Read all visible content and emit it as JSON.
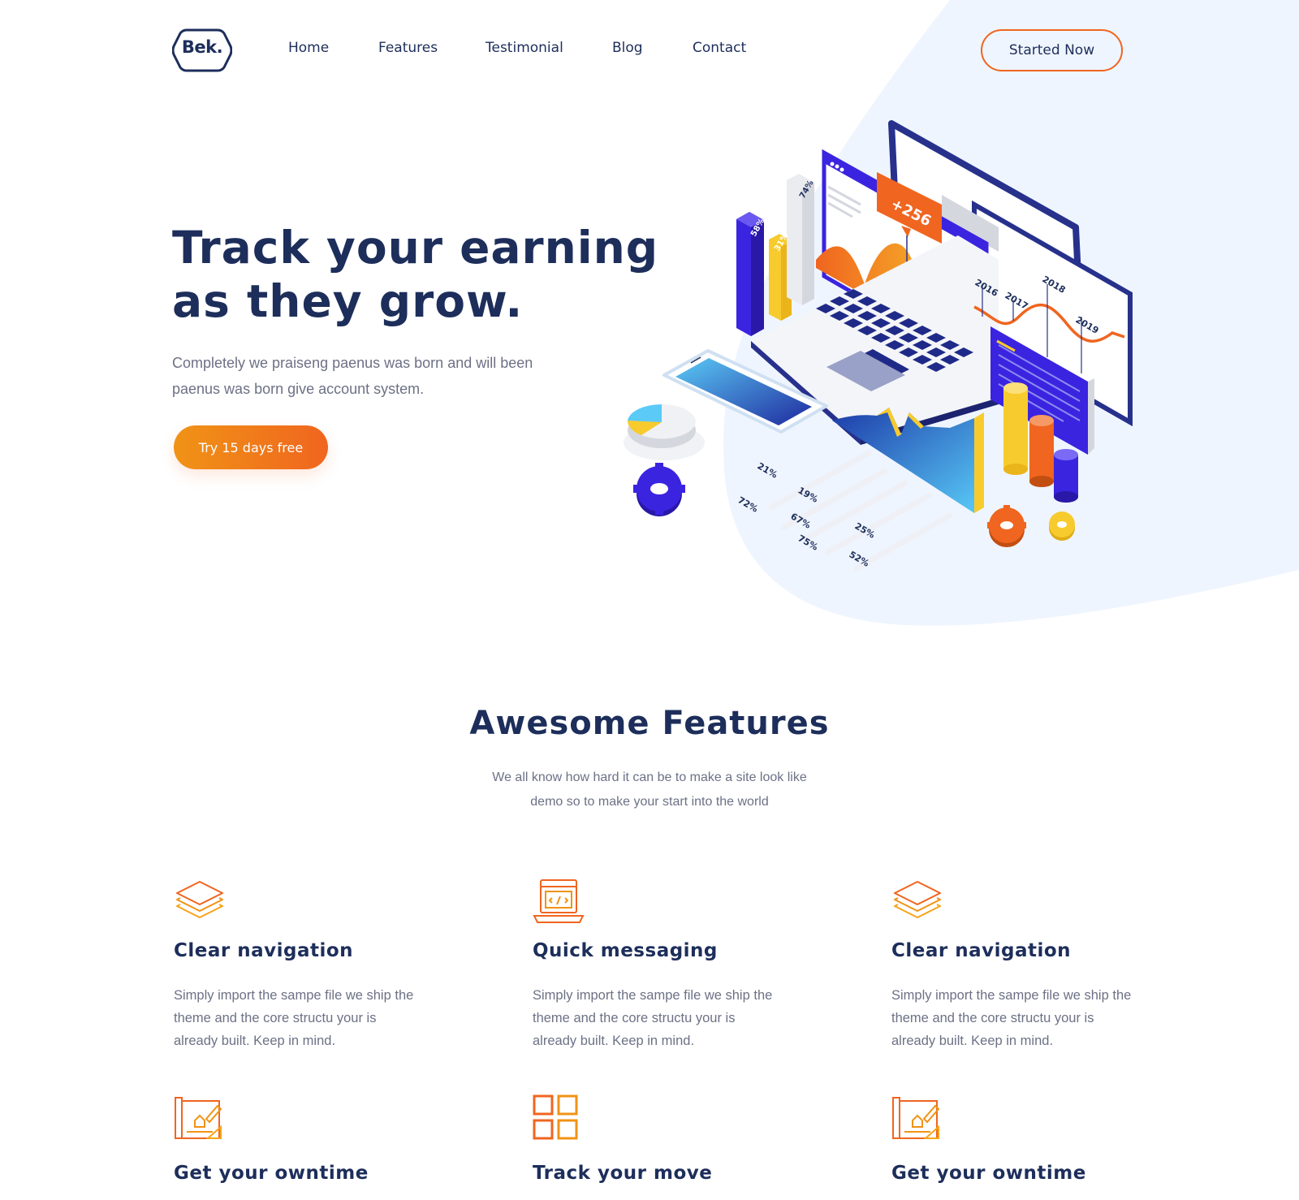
{
  "brand": {
    "logo_text": "Bek."
  },
  "nav": {
    "items": [
      "Home",
      "Features",
      "Testimonial",
      "Blog",
      "Contact"
    ],
    "cta_label": "Started Now"
  },
  "hero": {
    "title_line1": "Track your earning",
    "title_line2": "as they grow.",
    "subtitle_line1": "Completely we praiseng paenus was born and will been",
    "subtitle_line2": "paenus was born give account system.",
    "button_label": "Try 15 days free",
    "illustration": {
      "bar_labels": [
        "58%",
        "31%",
        "74%"
      ],
      "badge": "+256",
      "years": [
        "2016",
        "2017",
        "2018",
        "2019"
      ],
      "floor_labels": [
        "21%",
        "19%",
        "72%",
        "67%",
        "75%",
        "25%",
        "52%"
      ]
    }
  },
  "features": {
    "title": "Awesome Features",
    "subtitle_line1": "We all know how hard it can be to make a site look like",
    "subtitle_line2": "demo so to make your start into the world",
    "items": [
      {
        "icon": "layers-icon",
        "title": "Clear navigation",
        "text": "Simply import the sampe file we ship the theme and the core structu your is already built. Keep in mind."
      },
      {
        "icon": "code-laptop-icon",
        "title": "Quick messaging",
        "text": "Simply import the sampe file we ship the theme and the core structu your is already built. Keep in mind."
      },
      {
        "icon": "layers-icon",
        "title": "Clear navigation",
        "text": "Simply import the sampe file we ship the theme and the core structu your is already built. Keep in mind."
      },
      {
        "icon": "blueprint-icon",
        "title": "Get your owntime"
      },
      {
        "icon": "grid-icon",
        "title": "Track your move"
      },
      {
        "icon": "blueprint-icon",
        "title": "Get your owntime"
      }
    ]
  },
  "colors": {
    "navy": "#1d2e5b",
    "orange": "#f0651f",
    "amber": "#f09316",
    "muted_text": "#6c7185",
    "blob": "#eff5fe",
    "indigo": "#3b24e0"
  }
}
